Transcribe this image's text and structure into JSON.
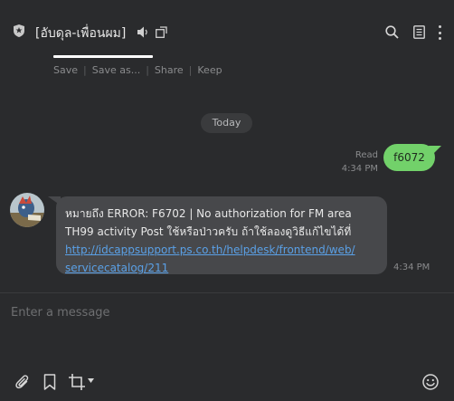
{
  "header": {
    "title": "[อับดุล-เพื่อนผม]",
    "icons": [
      "shield-icon",
      "mute-icon",
      "popout-icon",
      "search-icon",
      "notes-icon",
      "menu-icon"
    ]
  },
  "file_actions": {
    "save": "Save",
    "save_as": "Save as...",
    "share": "Share",
    "keep": "Keep"
  },
  "date_divider": "Today",
  "sent_message": {
    "read_label": "Read",
    "time": "4:34 PM",
    "text": "f6072"
  },
  "received_message": {
    "line1": "หมายถึง ERROR: F6702 | No authorization for FM area",
    "line2": "TH99 activity Post ใช้หรือป่าวครับ ถ้าใช้ลองดูวิธีแก้ไขได้ที่",
    "link_line1": "http://idcappsupport.ps.co.th/helpdesk/frontend/web/",
    "link_line2": "servicecatalog/211",
    "time": "4:34 PM"
  },
  "composer": {
    "placeholder": "Enter a message"
  },
  "colors": {
    "background": "#2a2b2d",
    "sent_bubble": "#72d16a",
    "received_bubble": "#47484b",
    "link": "#5aa0e6"
  }
}
